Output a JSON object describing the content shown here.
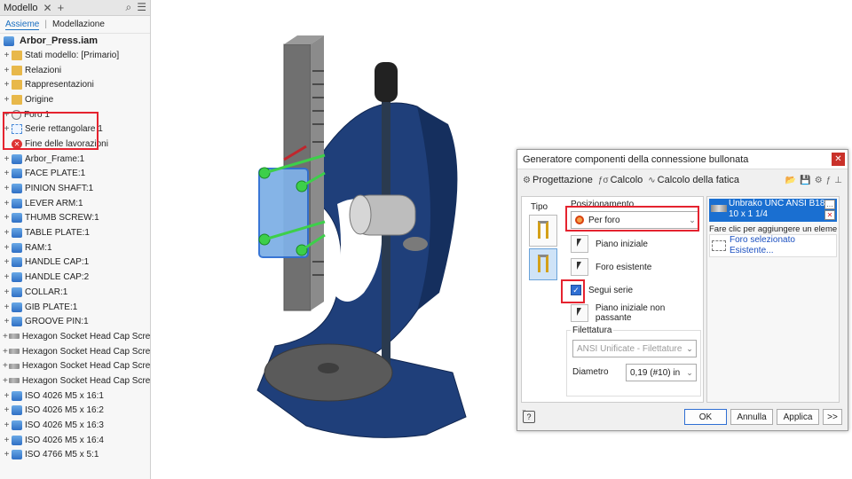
{
  "browser": {
    "tab_label": "Modello",
    "subtabs": [
      "Assieme",
      "Modellazione"
    ],
    "root": "Arbor_Press.iam",
    "items": [
      {
        "label": "Stati modello: [Primario]",
        "icon": "folder"
      },
      {
        "label": "Relazioni",
        "icon": "folder"
      },
      {
        "label": "Rappresentazioni",
        "icon": "folder"
      },
      {
        "label": "Origine",
        "icon": "folder"
      },
      {
        "label": "Foro 1",
        "icon": "hole"
      },
      {
        "label": "Serie rettangolare 1",
        "icon": "pattern"
      },
      {
        "label": "Fine delle lavorazioni",
        "icon": "end"
      },
      {
        "label": "Arbor_Frame:1",
        "icon": "part"
      },
      {
        "label": "FACE PLATE:1",
        "icon": "part"
      },
      {
        "label": "PINION SHAFT:1",
        "icon": "part"
      },
      {
        "label": "LEVER ARM:1",
        "icon": "part"
      },
      {
        "label": "THUMB SCREW:1",
        "icon": "part"
      },
      {
        "label": "TABLE PLATE:1",
        "icon": "part"
      },
      {
        "label": "RAM:1",
        "icon": "part"
      },
      {
        "label": "HANDLE CAP:1",
        "icon": "part"
      },
      {
        "label": "HANDLE CAP:2",
        "icon": "part"
      },
      {
        "label": "COLLAR:1",
        "icon": "part"
      },
      {
        "label": "GIB PLATE:1",
        "icon": "part"
      },
      {
        "label": "GROOVE PIN:1",
        "icon": "part"
      },
      {
        "label": "Hexagon Socket Head Cap Screw - In",
        "icon": "bolt"
      },
      {
        "label": "Hexagon Socket Head Cap Screw - In",
        "icon": "bolt"
      },
      {
        "label": "Hexagon Socket Head Cap Screw - In",
        "icon": "bolt"
      },
      {
        "label": "Hexagon Socket Head Cap Screw - In",
        "icon": "bolt"
      },
      {
        "label": "ISO 4026 M5 x 16:1",
        "icon": "part"
      },
      {
        "label": "ISO 4026 M5 x 16:2",
        "icon": "part"
      },
      {
        "label": "ISO 4026 M5 x 16:3",
        "icon": "part"
      },
      {
        "label": "ISO 4026 M5 x 16:4",
        "icon": "part"
      },
      {
        "label": "ISO 4766 M5 x 5:1",
        "icon": "part"
      }
    ]
  },
  "dialog": {
    "title": "Generatore componenti della connessione bullonata",
    "tabs": [
      "Progettazione",
      "Calcolo",
      "Calcolo della fatica"
    ],
    "tipo_label": "Tipo",
    "posizionamento_label": "Posizionamento",
    "placement_value": "Per foro",
    "options": [
      "Piano iniziale",
      "Foro esistente",
      "Piano iniziale non passante"
    ],
    "segui_serie": "Segui serie",
    "filettatura_label": "Filettatura",
    "thread_value": "ANSI Unificate - Filettature",
    "diametro_label": "Diametro",
    "diametro_value": "0,19 (#10) in",
    "component_line1": "Unbrako UNC ANSI B18....",
    "component_line2": "10 x 1 1/4",
    "add_hint": "Fare clic per aggiungere un element...",
    "hole_line1": "Foro selezionato",
    "hole_line2": "Esistente...",
    "buttons": {
      "ok": "OK",
      "cancel": "Annulla",
      "apply": "Applica",
      "more": ">>"
    }
  },
  "colors": {
    "frame": "#1f3f7a",
    "highlight": "#e5232f",
    "accent": "#1a6fd1"
  }
}
